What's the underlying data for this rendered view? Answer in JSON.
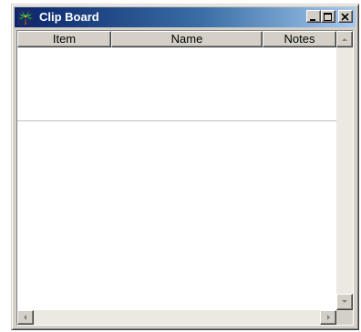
{
  "window": {
    "title": "Clip Board",
    "controls": {
      "minimize": "minimize-icon",
      "maximize": "maximize-icon",
      "close": "close-icon"
    }
  },
  "list": {
    "columns": [
      {
        "label": "Item"
      },
      {
        "label": "Name"
      },
      {
        "label": "Notes"
      }
    ],
    "rows": []
  },
  "icons": {
    "app": "palm-tree-icon",
    "scroll_up": "arrow-up-icon",
    "scroll_down": "arrow-down-icon",
    "scroll_left": "arrow-left-icon",
    "scroll_right": "arrow-right-icon"
  },
  "colors": {
    "titlebar_start": "#0a246a",
    "titlebar_end": "#a6caf0",
    "face": "#d4d0c8"
  }
}
